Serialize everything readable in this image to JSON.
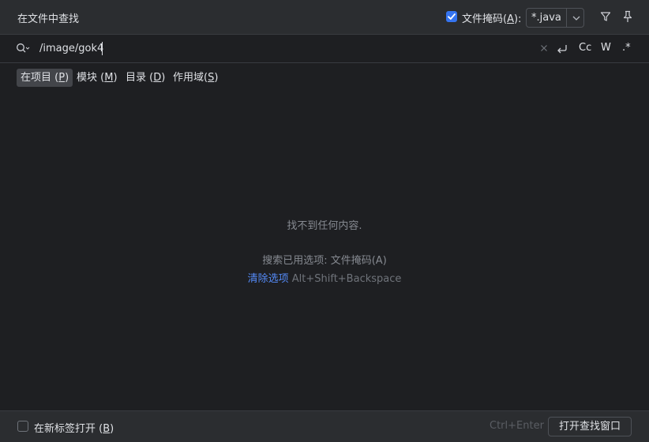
{
  "dialog": {
    "title": "在文件中查找",
    "file_mask": {
      "checked": true,
      "label_pre": "文件掩码(",
      "label_mnemonic": "A",
      "label_post": "):",
      "value": "*.java"
    }
  },
  "search": {
    "query": "/image/gok4",
    "options": {
      "match_case": "Cc",
      "words": "W",
      "regex": ".*"
    }
  },
  "scopes": [
    {
      "pre": "在项目 (",
      "key": "P",
      "post": ")",
      "active": true
    },
    {
      "pre": "模块 (",
      "key": "M",
      "post": ")",
      "active": false
    },
    {
      "pre": "目录 (",
      "key": "D",
      "post": ")",
      "active": false
    },
    {
      "pre": "作用域(",
      "key": "S",
      "post": ")",
      "active": false
    }
  ],
  "results": {
    "empty_message": "找不到任何内容.",
    "used_options": "搜索已用选项: 文件掩码(A)",
    "clear_link": "清除选项",
    "clear_shortcut": "Alt+Shift+Backspace"
  },
  "footer": {
    "new_tab_pre": "在新标签打开 (",
    "new_tab_key": "B",
    "new_tab_post": ")",
    "new_tab_checked": false,
    "shortcut_hint": "Ctrl+Enter",
    "open_button": "打开查找窗口"
  },
  "colors": {
    "accent": "#3574f0",
    "link": "#548af7",
    "background": "#2b2d30",
    "panel": "#1e1f22"
  }
}
